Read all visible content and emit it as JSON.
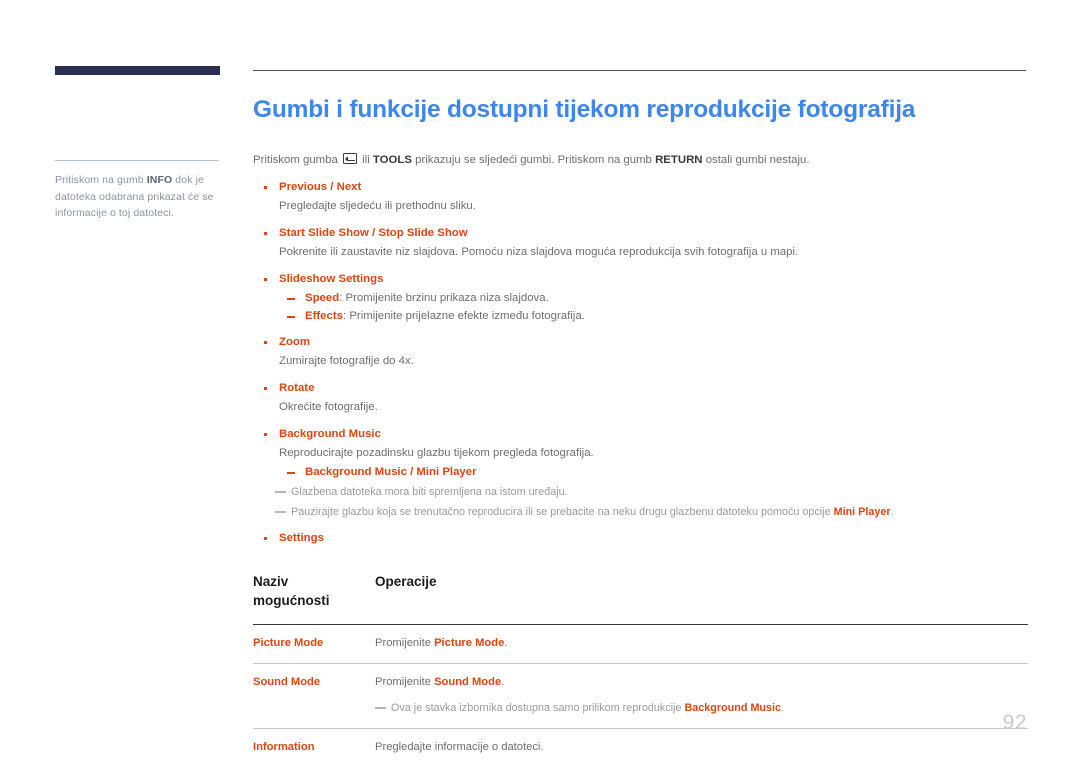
{
  "document": {
    "page_number": "92",
    "title": "Gumbi i funkcije dostupni tijekom reprodukcije fotografija"
  },
  "sidebar": {
    "note_part1": "Pritiskom na gumb ",
    "note_bold": "INFO",
    "note_part2": " dok je datoteka odabrana prikazat će se informacije o toj datoteci."
  },
  "intro": {
    "part1": "Pritiskom gumba ",
    "icon": "enter-key-icon",
    "part2": " ili ",
    "bold1": "TOOLS",
    "part3": " prikazuju se sljedeći gumbi. Pritiskom na gumb ",
    "bold2": "RETURN",
    "part4": " ostali gumbi nestaju."
  },
  "bullets": [
    {
      "title": "Previous / Next",
      "desc": "Pregledajte sljedeću ili prethodnu sliku."
    },
    {
      "title": "Start Slide Show / Stop Slide Show",
      "desc": "Pokrenite ili zaustavite niz slajdova. Pomoću niza slajdova moguća reprodukcija svih fotografija u mapi."
    },
    {
      "title": "Slideshow Settings",
      "desc": "",
      "sub": [
        {
          "label": "Speed",
          "text": ": Promijenite brzinu prikaza niza slajdova."
        },
        {
          "label": "Effects",
          "text": ": Primijenite prijelazne efekte između fotografija."
        }
      ]
    },
    {
      "title": "Zoom",
      "desc": "Zumirajte fotografije do 4x."
    },
    {
      "title": "Rotate",
      "desc": "Okrećite fotografije."
    },
    {
      "title": "Background Music",
      "desc": "Reproducirajte pozadinsku glazbu tijekom pregleda fotografija.",
      "sub_red": "Background Music / Mini Player",
      "notes": [
        {
          "text": "Glazbena datoteka mora biti spremljena na istom uređaju.",
          "bold": "",
          "tail": ""
        },
        {
          "text": "Pauzirajte glazbu koja se trenutačno reproducira ili se prebacite na neku drugu glazbenu datoteku pomoću opcije ",
          "bold": "Mini Player",
          "tail": "."
        }
      ]
    },
    {
      "title": "Settings",
      "desc": ""
    }
  ],
  "table": {
    "headers": {
      "col1": "Naziv mogućnosti",
      "col2": "Operacije"
    },
    "rows": [
      {
        "name": "Picture Mode",
        "op_pre": "Promijenite ",
        "op_bold": "Picture Mode",
        "op_post": ".",
        "note_pre": "",
        "note_bold": "",
        "note_post": ""
      },
      {
        "name": "Sound Mode",
        "op_pre": "Promijenite ",
        "op_bold": "Sound Mode",
        "op_post": ".",
        "note_pre": "Ova je stavka izbornika dostupna samo prilikom reprodukcije ",
        "note_bold": "Background Music",
        "note_post": "."
      },
      {
        "name": "Information",
        "op_pre": "Pregledajte informacije o datoteci.",
        "op_bold": "",
        "op_post": "",
        "note_pre": "",
        "note_bold": "",
        "note_post": ""
      }
    ]
  },
  "colors": {
    "title_blue": "#3d86ef",
    "accent_orange": "#e0440f",
    "body_gray": "#6e6e6e",
    "note_gray": "#9a9a9a",
    "navy_bar": "#2a2f52"
  }
}
